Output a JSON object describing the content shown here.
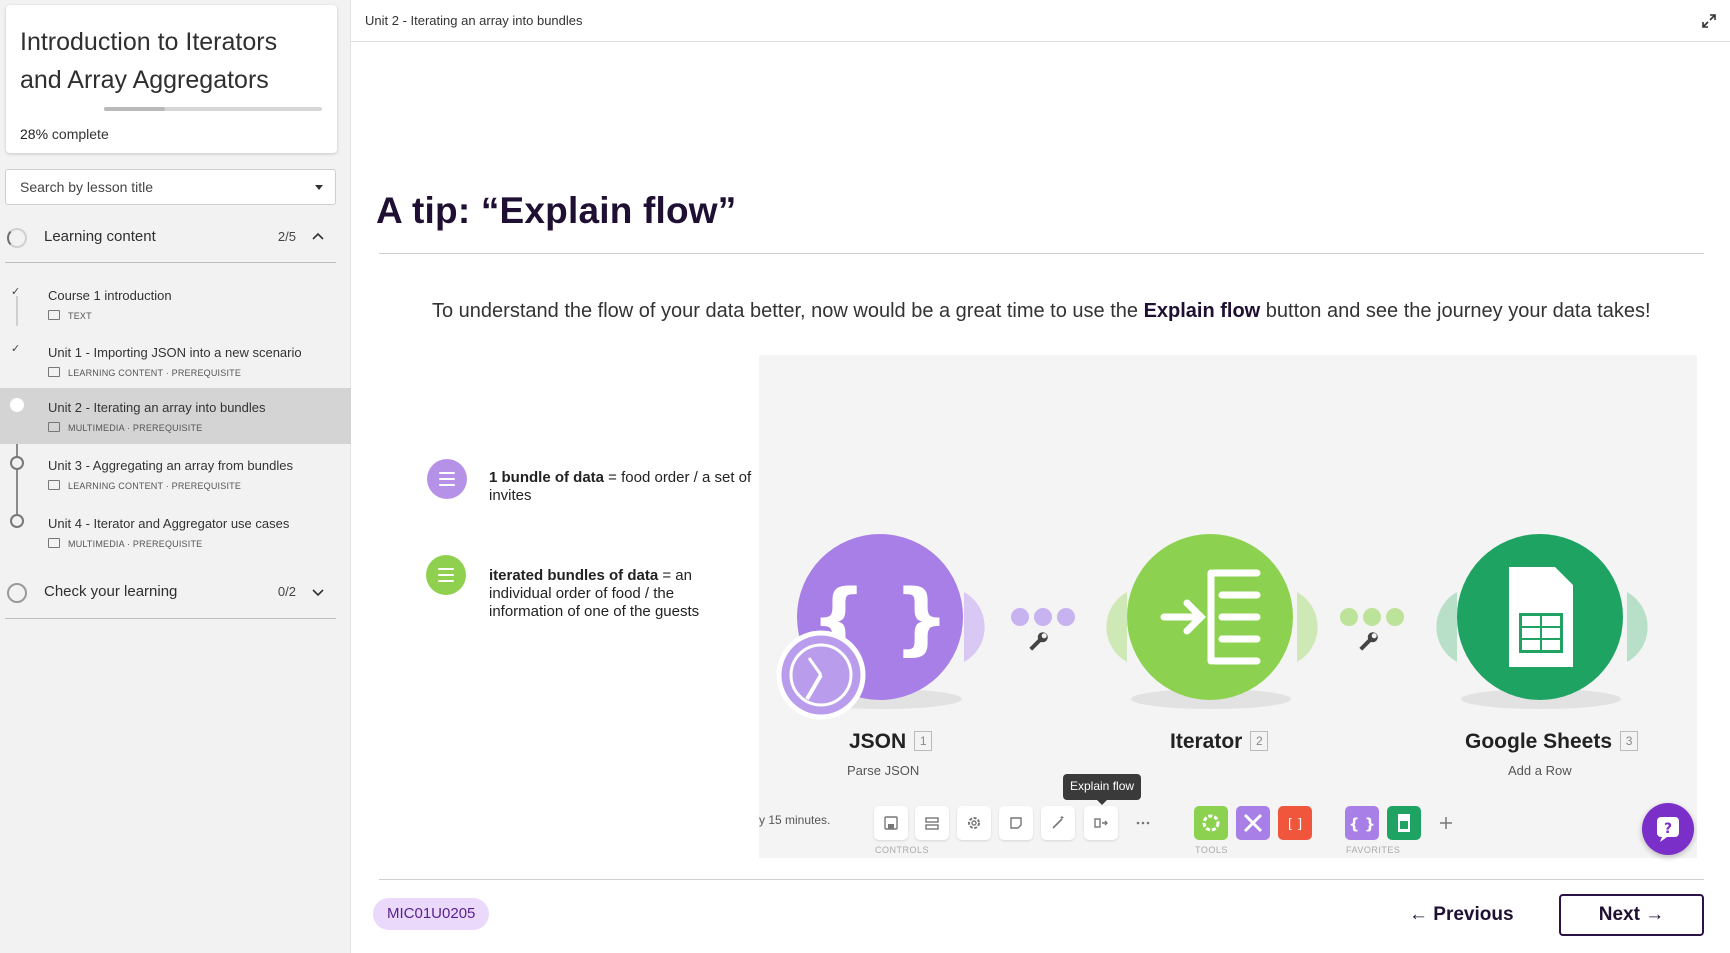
{
  "sidebar": {
    "course_title": "Introduction to Iterators and Array Aggregators",
    "progress": {
      "percent_label": "28%",
      "suffix": " complete",
      "fraction": 0.28
    },
    "search_placeholder": "Search by lesson title",
    "sections": [
      {
        "title": "Learning content",
        "count": "2/5",
        "expanded": true
      },
      {
        "title": "Check your learning",
        "count": "0/2",
        "expanded": false
      }
    ],
    "lessons": [
      {
        "name": "Course 1 introduction",
        "meta": "TEXT",
        "status": "done"
      },
      {
        "name": "Unit 1 - Importing JSON into a new scenario",
        "meta": "LEARNING CONTENT · PREREQUISITE",
        "status": "done"
      },
      {
        "name": "Unit 2 - Iterating an array into bundles",
        "meta": "MULTIMEDIA · PREREQUISITE",
        "status": "current"
      },
      {
        "name": "Unit 3 - Aggregating an array from bundles",
        "meta": "LEARNING CONTENT · PREREQUISITE",
        "status": "todo"
      },
      {
        "name": "Unit 4 - Iterator and Aggregator use cases",
        "meta": "MULTIMEDIA · PREREQUISITE",
        "status": "todo"
      }
    ]
  },
  "topbar": {
    "title": "Unit 2 - Iterating an array into bundles",
    "expand_icon": "expand-icon"
  },
  "main": {
    "heading": "A tip: “Explain flow”",
    "intro_before": "To understand the flow of your data better, now would be a great time to use the ",
    "intro_bold": "Explain flow",
    "intro_after": " button and see the journey your data takes!",
    "legend": [
      {
        "bold": "1 bundle of data",
        "text": " = food order / a set of invites",
        "color": "#b592e8"
      },
      {
        "bold": "iterated bundles of data",
        "text": " = an individual order of food / the information of one of the guests",
        "color": "#8fd14f"
      }
    ],
    "nodes": [
      {
        "label": "JSON",
        "num": "1",
        "sub": "Parse JSON",
        "color": "#a77fe6"
      },
      {
        "label": "Iterator",
        "num": "2",
        "sub": "",
        "color": "#8cd250"
      },
      {
        "label": "Google Sheets",
        "num": "3",
        "sub": "Add a Row",
        "color": "#1ea362"
      }
    ],
    "schedule_text": "y 15 minutes.",
    "tooltip": "Explain flow",
    "toolbar_captions": {
      "controls": "CONTROLS",
      "tools": "TOOLS",
      "favorites": "FAVORITES"
    },
    "colors": {
      "json": "#a77fe6",
      "iterator": "#8cd250",
      "sheets": "#1ea362",
      "tool_red": "#f0563b",
      "tool_purple": "#a77fe6",
      "fab": "#7b2fc9"
    }
  },
  "footer": {
    "code": "MIC01U0205",
    "previous_label": "← Previous",
    "next_label": "Next →"
  }
}
